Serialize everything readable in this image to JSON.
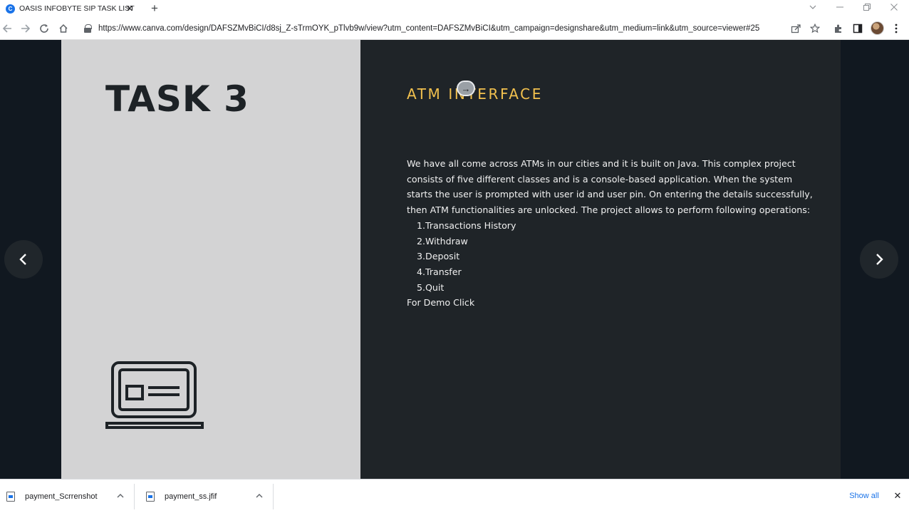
{
  "browser": {
    "tab_title": "OASIS INFOBYTE SIP TASK LIST",
    "tab_close": "✕",
    "new_tab": "+",
    "url": "https://www.canva.com/design/DAFSZMvBiCI/d8sj_Z-sTrmOYK_pTlvb9w/view?utm_content=DAFSZMvBiCI&utm_campaign=designshare&utm_medium=link&utm_source=viewer#25"
  },
  "slide": {
    "task_title": "TASK 3",
    "heading": "ATM INTERFACE",
    "body_paragraph": "We have all come across ATMs in our cities and it is built on Java. This complex project consists of five different classes and is a console-based application. When the system starts the user is prompted with user id and user pin. On entering the details successfully, then ATM functionalities are unlocked. The project allows to perform following operations:",
    "operations": [
      {
        "num": "1.",
        "label": "Transactions History"
      },
      {
        "num": "2.",
        "label": "Withdraw"
      },
      {
        "num": "3.",
        "label": "Deposit"
      },
      {
        "num": "4.",
        "label": "Transfer"
      },
      {
        "num": "5.",
        "label": "Quit"
      }
    ],
    "demo_text": "For Demo Click"
  },
  "downloads": {
    "items": [
      {
        "name": "payment_Scrrenshot"
      },
      {
        "name": "payment_ss.jfif"
      }
    ],
    "show_all": "Show all",
    "close": "✕"
  },
  "colors": {
    "heading_accent": "#f2c14e",
    "left_panel": "#d3d3d4",
    "right_panel": "#1f2428",
    "stage_bg": "#111820"
  }
}
